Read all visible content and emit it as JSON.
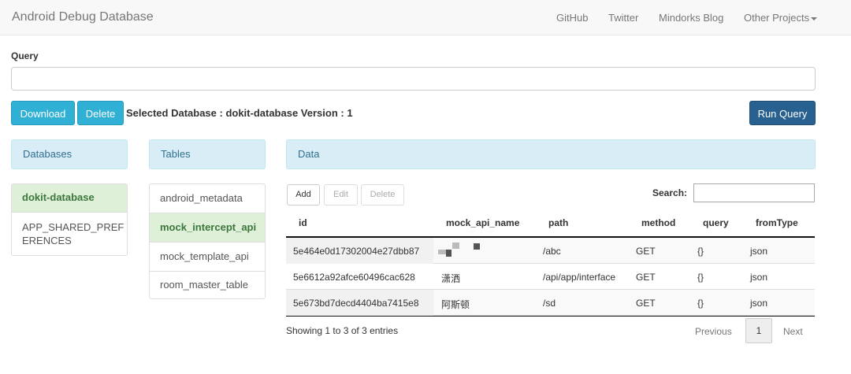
{
  "navbar": {
    "brand": "Android Debug Database",
    "links": [
      "GitHub",
      "Twitter",
      "Mindorks Blog",
      "Other Projects"
    ]
  },
  "query": {
    "label": "Query",
    "value": "",
    "download_label": "Download",
    "delete_label": "Delete",
    "selected_database": "Selected Database : dokit-database Version : 1",
    "run_label": "Run Query"
  },
  "databases": {
    "title": "Databases",
    "items": [
      "dokit-database",
      "APP_SHARED_PREF",
      "ERENCES"
    ]
  },
  "tables": {
    "title": "Tables",
    "items": [
      "android_metadata",
      "mock_intercept_api",
      "mock_template_api",
      "room_master_table"
    ]
  },
  "data": {
    "title": "Data",
    "add_label": "Add",
    "edit_label": "Edit",
    "delete_label": "Delete",
    "search_label": "Search:",
    "search_value": "",
    "columns": [
      "id",
      "mock_api_name",
      "path",
      "method",
      "query",
      "fromType"
    ],
    "rows": [
      [
        "5e464e0d17302004e27dbb87",
        "",
        "/abc",
        "GET",
        "{}",
        "json"
      ],
      [
        "5e6612a92afce60496cac628",
        "潇洒",
        "/api/app/interface",
        "GET",
        "{}",
        "json"
      ],
      [
        "5e673bd7decd4404ba7415e8",
        "阿斯顿",
        "/sd",
        "GET",
        "{}",
        "json"
      ]
    ],
    "showing": "Showing 1 to 3 of 3 entries",
    "previous_label": "Previous",
    "current_page": "1",
    "next_label": "Next"
  },
  "colors": {
    "info": "#31b0d5",
    "primary": "#286090",
    "panel_heading": "#d9edf7",
    "active_item": "#dff0d8"
  }
}
